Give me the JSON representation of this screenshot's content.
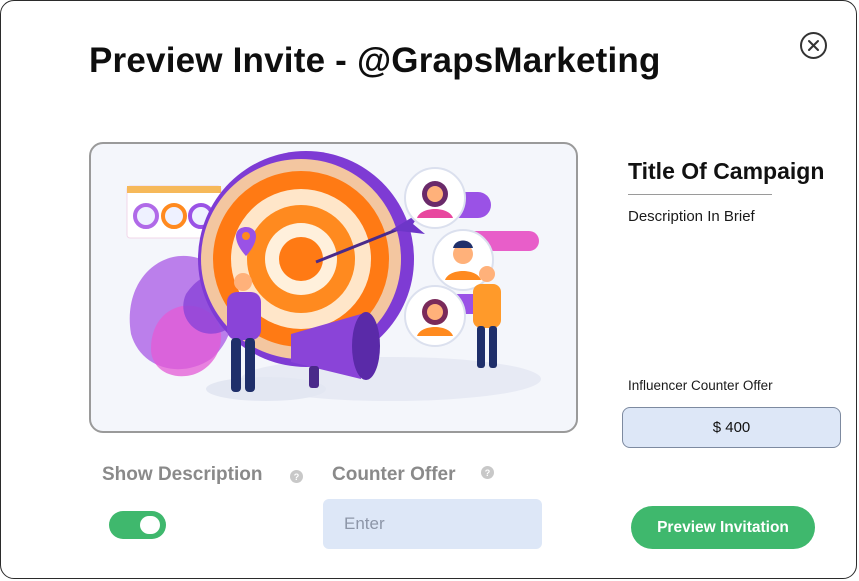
{
  "modal": {
    "title": "Preview Invite - @GrapsMarketing",
    "close_icon": "close-icon"
  },
  "hero": {
    "illustration": "marketing-target-illustration"
  },
  "campaign": {
    "title": "Title Of Campaign",
    "description": "Description In Brief",
    "counter_offer_label": "Influencer Counter Offer",
    "counter_offer_value": "$ 400"
  },
  "controls": {
    "show_description_label": "Show Description",
    "show_description_on": true,
    "help_glyph": "?",
    "counter_offer_label": "Counter Offer",
    "counter_offer_placeholder": "Enter",
    "preview_button": "Preview Invitation"
  },
  "colors": {
    "accent_green": "#3fb86d",
    "input_bg": "#dde7f7",
    "target_orange": "#ff8a1f",
    "purple": "#8a44d8"
  }
}
